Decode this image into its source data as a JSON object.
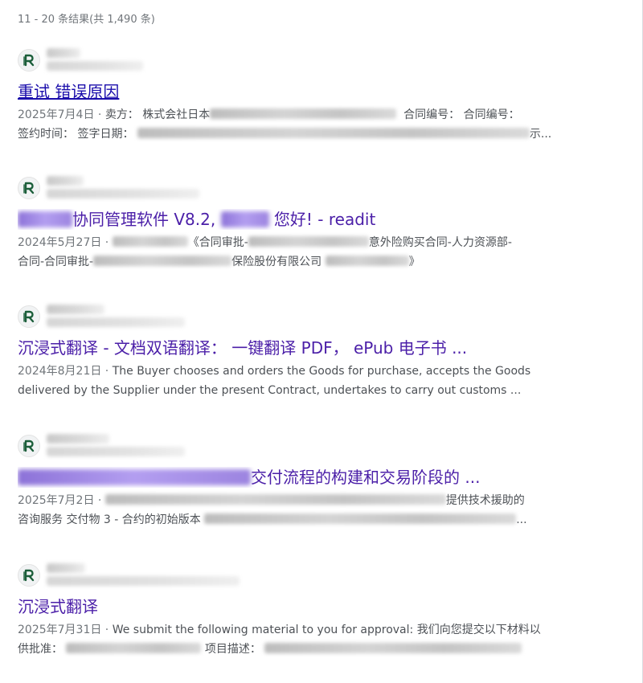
{
  "results_stats": "11 - 20 条结果(共 1,490 条)",
  "colors": {
    "title": "#4b1fa8",
    "title_visited_link": "#1a0dab",
    "snippet": "#4d5156",
    "meta": "#70757a"
  },
  "favicon_icon": "readit-logo-icon",
  "results": [
    {
      "title_parts": [
        "重试 错误原因"
      ],
      "date": "2025年7月4日",
      "snippet_line1": [
        "卖方： 株式会社日本",
        "合同编号： 合同编号："
      ],
      "snippet_line2": [
        "签约时间： 签字日期：",
        "示..."
      ]
    },
    {
      "title_parts": [
        "协同管理软件 V8.2,",
        "您好! - readit"
      ],
      "date": "2024年5月27日",
      "snippet_line1": [
        "《合同审批-",
        "意外险购买合同-人力资源部-"
      ],
      "snippet_line2": [
        "合同-合同审批-",
        "保险股份有限公司",
        "》"
      ]
    },
    {
      "title_parts": [
        "沉浸式翻译 - 文档双语翻译： 一键翻译 PDF， ePub 电子书 ..."
      ],
      "date": "2024年8月21日",
      "snippet_line1": [
        "The Buyer chooses and orders the Goods for purchase, accepts the Goods"
      ],
      "snippet_line2": [
        "delivered by the Supplier under the present Contract, undertakes to carry out customs ..."
      ]
    },
    {
      "title_parts": [
        "交付流程的构建和交易阶段的 ..."
      ],
      "date": "2025年7月2日",
      "snippet_line1": [
        "提供技术援助的"
      ],
      "snippet_line2": [
        "咨询服务 交付物 3 - 合约的初始版本",
        "..."
      ]
    },
    {
      "title_parts": [
        "沉浸式翻译"
      ],
      "date": "2025年7月31日",
      "snippet_line1": [
        "We submit the following material to you for approval: 我们向您提交以下材料以"
      ],
      "snippet_line2": [
        "供批准：",
        "项目描述："
      ]
    }
  ]
}
